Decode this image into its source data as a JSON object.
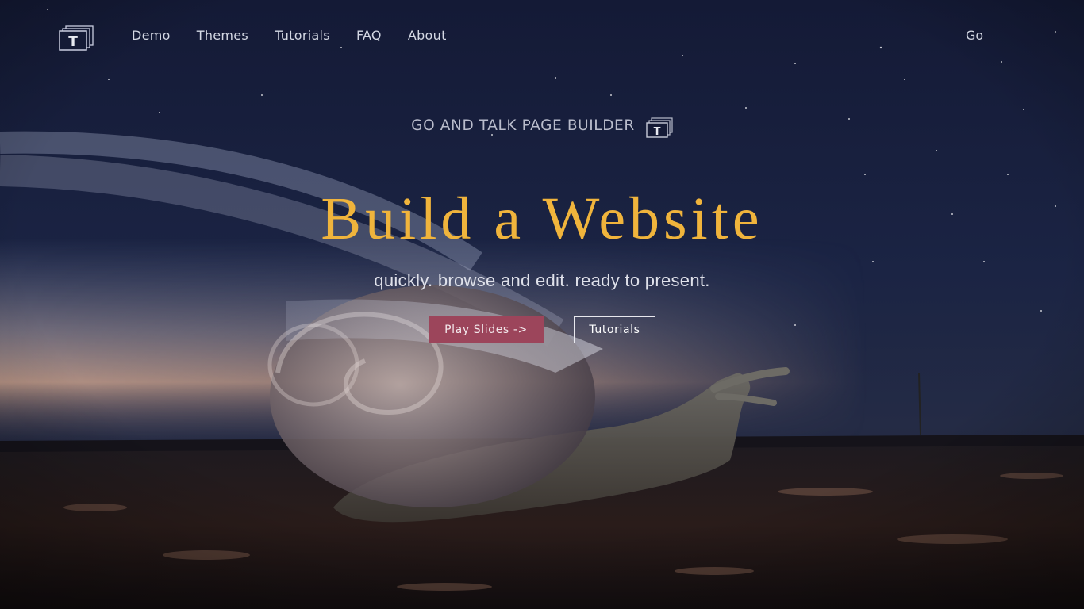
{
  "nav": {
    "logo_letter": "T",
    "links": [
      "Demo",
      "Themes",
      "Tutorials",
      "FAQ",
      "About"
    ],
    "go_label": "Go"
  },
  "hero": {
    "kicker": "GO AND TALK PAGE BUILDER",
    "kicker_icon_letter": "T",
    "headline": "Build a Website",
    "subtitle": "quickly. browse and edit. ready to present.",
    "primary_button": "Play Slides ->",
    "secondary_button": "Tutorials"
  },
  "icons": {
    "logo": "stacked-pages-t-icon",
    "kicker_icon": "stacked-pages-t-icon"
  },
  "colors": {
    "headline": "#f0b43c",
    "primary_button": "#9c455b",
    "sky": "#0f1530"
  }
}
